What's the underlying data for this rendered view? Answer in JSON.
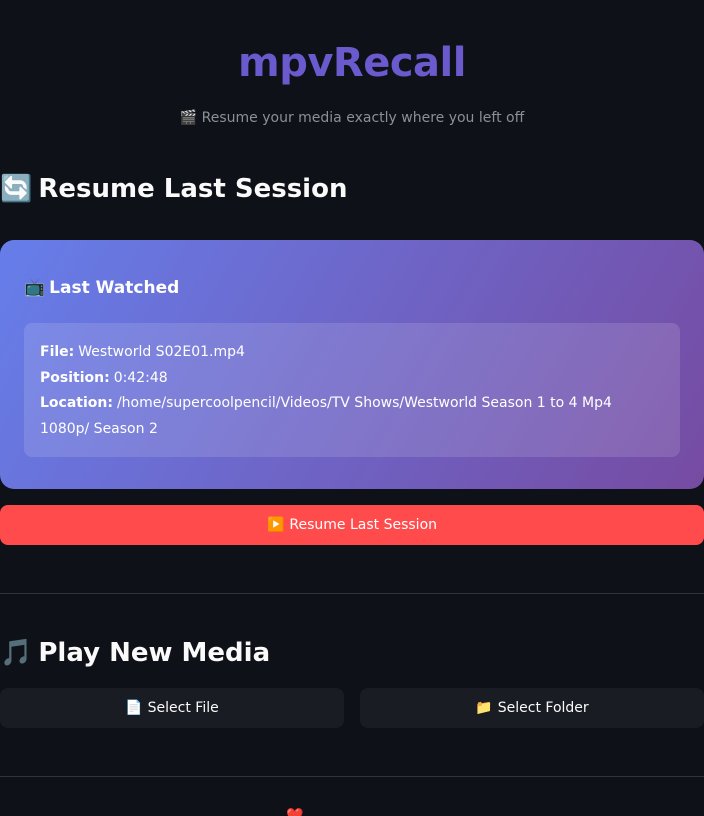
{
  "app": {
    "title": "mpvRecall",
    "subtitle": "🎬 Resume your media exactly where you left off"
  },
  "resume_section": {
    "icon": "🔄",
    "icon_name": "refresh-icon",
    "title": "Resume Last Session",
    "card": {
      "icon": "📺",
      "icon_name": "tv-icon",
      "title": "Last Watched",
      "file_label": "File:",
      "file_value": "Westworld S02E01.mp4",
      "position_label": "Position:",
      "position_value": "0:42:48",
      "location_label": "Location:",
      "location_value": "/home/supercoolpencil/Videos/TV Shows/Westworld Season 1 to 4 Mp4 1080p/ Season 2"
    },
    "resume_button": {
      "icon": "▶️",
      "icon_name": "play-icon",
      "label": "Resume Last Session"
    }
  },
  "play_section": {
    "icon": "🎵",
    "icon_name": "music-note-icon",
    "title": "Play New Media",
    "select_file_button": {
      "icon": "📄",
      "icon_name": "file-icon",
      "label": "Select File"
    },
    "select_folder_button": {
      "icon": "📁",
      "icon_name": "folder-icon",
      "label": "Select Folder"
    }
  },
  "footer": {
    "heart": "❤️",
    "heart_icon_name": "heart-icon"
  },
  "colors": {
    "background": "#0e1117",
    "title_accent": "#6a5acd",
    "card_gradient_start": "#667eea",
    "card_gradient_end": "#764ba2",
    "primary_button": "#ff4b4b",
    "secondary_button": "#1a1c24"
  }
}
